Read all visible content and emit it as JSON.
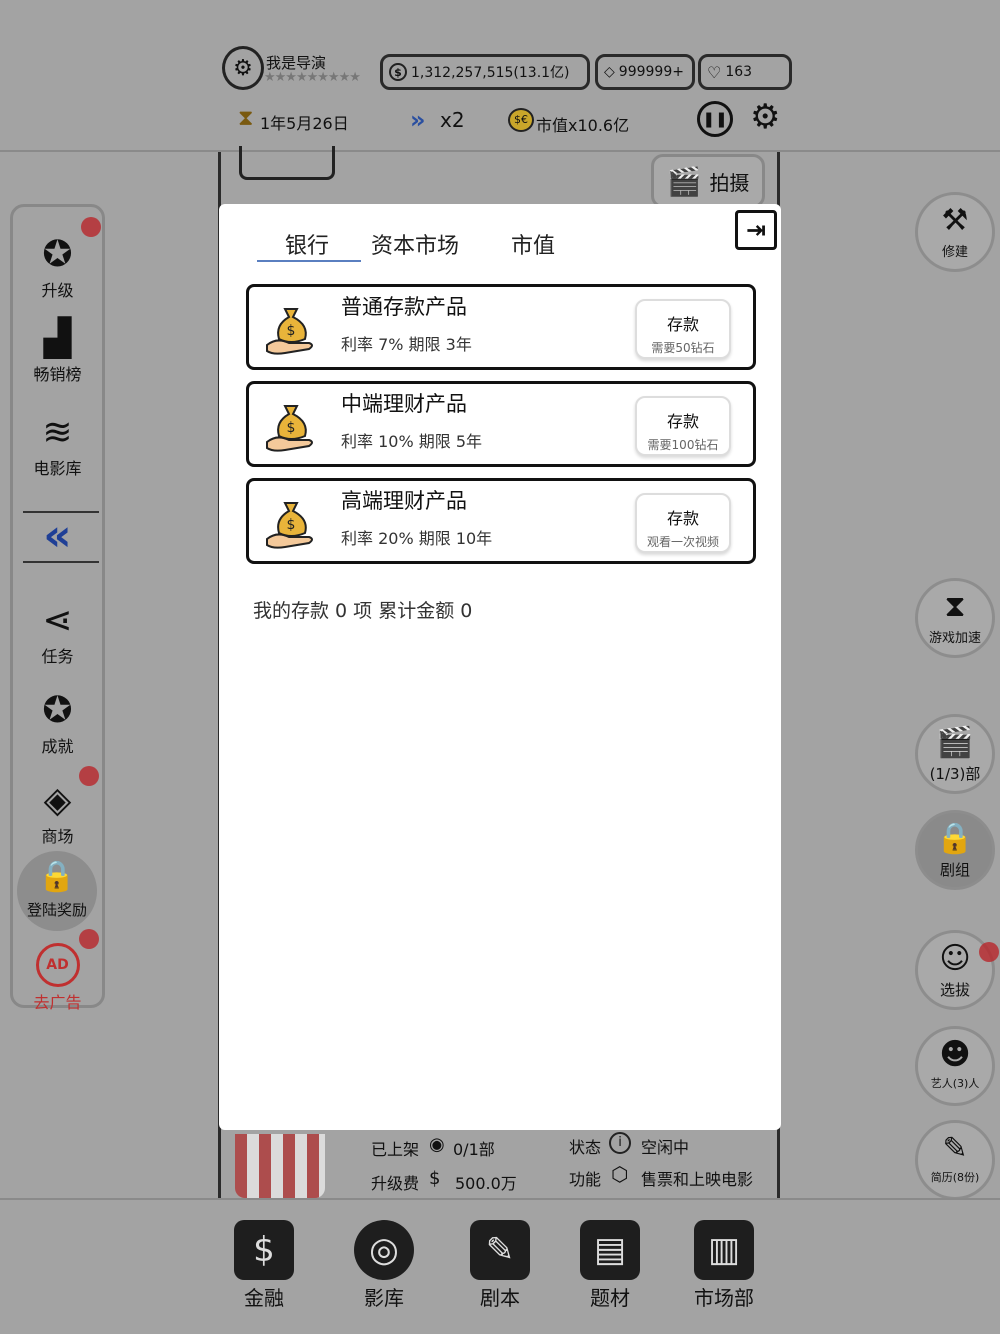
{
  "header": {
    "director_name": "我是导演",
    "money": "1,312,257,515(13.1亿)",
    "diamonds": "999999+",
    "hearts": "163",
    "date": "1年5月26日",
    "speed": "x2",
    "market_value": "市值x10.6亿"
  },
  "film_button": "拍摄",
  "left_sidebar": {
    "items": [
      {
        "label": "升级"
      },
      {
        "label": "畅销榜"
      },
      {
        "label": "电影库"
      },
      {
        "label": "任务"
      },
      {
        "label": "成就"
      },
      {
        "label": "商场"
      },
      {
        "label": "登陆奖励"
      },
      {
        "label": "去广告"
      }
    ],
    "collapse_glyph": "«"
  },
  "right_sidebar": {
    "items": [
      {
        "label": "修建"
      },
      {
        "label": "游戏加速"
      },
      {
        "label": "(1/3)部"
      },
      {
        "label": "剧组"
      },
      {
        "label": "选拔"
      },
      {
        "label": "艺人(3)人"
      },
      {
        "label": "简历(8份)"
      }
    ]
  },
  "modal": {
    "tabs": [
      {
        "label": "银行",
        "active": true
      },
      {
        "label": "资本市场",
        "active": false
      },
      {
        "label": "市值",
        "active": false
      }
    ],
    "products": [
      {
        "title": "普通存款产品",
        "desc": "利率 7% 期限 3年",
        "button": "存款",
        "button_sub": "需要50钻石"
      },
      {
        "title": "中端理财产品",
        "desc": "利率 10% 期限 5年",
        "button": "存款",
        "button_sub": "需要100钻石"
      },
      {
        "title": "高端理财产品",
        "desc": "利率 20% 期限 10年",
        "button": "存款",
        "button_sub": "观看一次视频"
      }
    ],
    "summary": "我的存款 0 项  累计金额 0"
  },
  "background_info": {
    "listed_label": "已上架",
    "listed_value": "0/1部",
    "upgrade_label": "升级费",
    "upgrade_value": "500.0万",
    "status_label": "状态",
    "status_value": "空闲中",
    "function_label": "功能",
    "function_value": "售票和上映电影"
  },
  "bottom_nav": {
    "items": [
      {
        "label": "金融"
      },
      {
        "label": "影库"
      },
      {
        "label": "剧本"
      },
      {
        "label": "题材"
      },
      {
        "label": "市场部"
      }
    ]
  },
  "colors": {
    "dim_background": "#a3a3a3",
    "accent_underline": "#5a7fc0",
    "badge_red": "#b8262a",
    "ad_red": "#c03030"
  }
}
